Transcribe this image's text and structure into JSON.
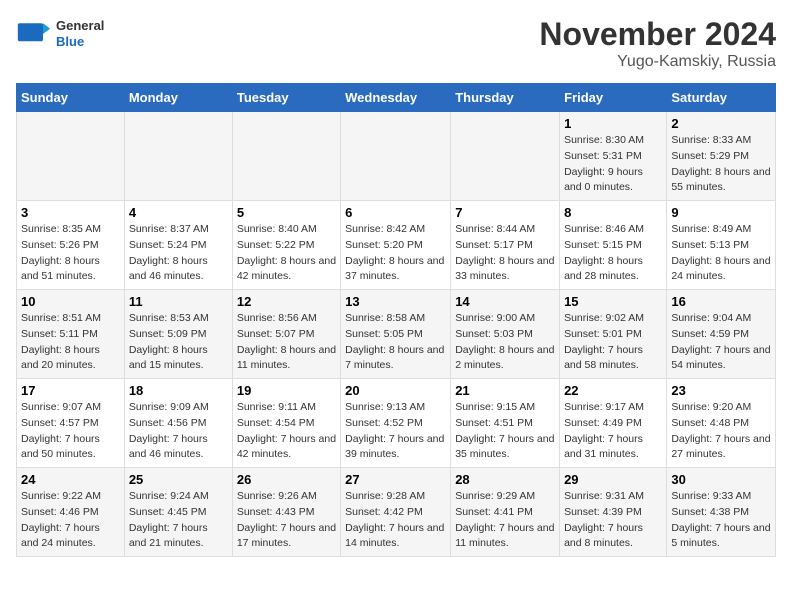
{
  "header": {
    "title": "November 2024",
    "subtitle": "Yugo-Kamskiy, Russia",
    "logo_general": "General",
    "logo_blue": "Blue"
  },
  "weekdays": [
    "Sunday",
    "Monday",
    "Tuesday",
    "Wednesday",
    "Thursday",
    "Friday",
    "Saturday"
  ],
  "weeks": [
    [
      {
        "day": "",
        "sunrise": "",
        "sunset": "",
        "daylight": ""
      },
      {
        "day": "",
        "sunrise": "",
        "sunset": "",
        "daylight": ""
      },
      {
        "day": "",
        "sunrise": "",
        "sunset": "",
        "daylight": ""
      },
      {
        "day": "",
        "sunrise": "",
        "sunset": "",
        "daylight": ""
      },
      {
        "day": "",
        "sunrise": "",
        "sunset": "",
        "daylight": ""
      },
      {
        "day": "1",
        "sunrise": "Sunrise: 8:30 AM",
        "sunset": "Sunset: 5:31 PM",
        "daylight": "Daylight: 9 hours and 0 minutes."
      },
      {
        "day": "2",
        "sunrise": "Sunrise: 8:33 AM",
        "sunset": "Sunset: 5:29 PM",
        "daylight": "Daylight: 8 hours and 55 minutes."
      }
    ],
    [
      {
        "day": "3",
        "sunrise": "Sunrise: 8:35 AM",
        "sunset": "Sunset: 5:26 PM",
        "daylight": "Daylight: 8 hours and 51 minutes."
      },
      {
        "day": "4",
        "sunrise": "Sunrise: 8:37 AM",
        "sunset": "Sunset: 5:24 PM",
        "daylight": "Daylight: 8 hours and 46 minutes."
      },
      {
        "day": "5",
        "sunrise": "Sunrise: 8:40 AM",
        "sunset": "Sunset: 5:22 PM",
        "daylight": "Daylight: 8 hours and 42 minutes."
      },
      {
        "day": "6",
        "sunrise": "Sunrise: 8:42 AM",
        "sunset": "Sunset: 5:20 PM",
        "daylight": "Daylight: 8 hours and 37 minutes."
      },
      {
        "day": "7",
        "sunrise": "Sunrise: 8:44 AM",
        "sunset": "Sunset: 5:17 PM",
        "daylight": "Daylight: 8 hours and 33 minutes."
      },
      {
        "day": "8",
        "sunrise": "Sunrise: 8:46 AM",
        "sunset": "Sunset: 5:15 PM",
        "daylight": "Daylight: 8 hours and 28 minutes."
      },
      {
        "day": "9",
        "sunrise": "Sunrise: 8:49 AM",
        "sunset": "Sunset: 5:13 PM",
        "daylight": "Daylight: 8 hours and 24 minutes."
      }
    ],
    [
      {
        "day": "10",
        "sunrise": "Sunrise: 8:51 AM",
        "sunset": "Sunset: 5:11 PM",
        "daylight": "Daylight: 8 hours and 20 minutes."
      },
      {
        "day": "11",
        "sunrise": "Sunrise: 8:53 AM",
        "sunset": "Sunset: 5:09 PM",
        "daylight": "Daylight: 8 hours and 15 minutes."
      },
      {
        "day": "12",
        "sunrise": "Sunrise: 8:56 AM",
        "sunset": "Sunset: 5:07 PM",
        "daylight": "Daylight: 8 hours and 11 minutes."
      },
      {
        "day": "13",
        "sunrise": "Sunrise: 8:58 AM",
        "sunset": "Sunset: 5:05 PM",
        "daylight": "Daylight: 8 hours and 7 minutes."
      },
      {
        "day": "14",
        "sunrise": "Sunrise: 9:00 AM",
        "sunset": "Sunset: 5:03 PM",
        "daylight": "Daylight: 8 hours and 2 minutes."
      },
      {
        "day": "15",
        "sunrise": "Sunrise: 9:02 AM",
        "sunset": "Sunset: 5:01 PM",
        "daylight": "Daylight: 7 hours and 58 minutes."
      },
      {
        "day": "16",
        "sunrise": "Sunrise: 9:04 AM",
        "sunset": "Sunset: 4:59 PM",
        "daylight": "Daylight: 7 hours and 54 minutes."
      }
    ],
    [
      {
        "day": "17",
        "sunrise": "Sunrise: 9:07 AM",
        "sunset": "Sunset: 4:57 PM",
        "daylight": "Daylight: 7 hours and 50 minutes."
      },
      {
        "day": "18",
        "sunrise": "Sunrise: 9:09 AM",
        "sunset": "Sunset: 4:56 PM",
        "daylight": "Daylight: 7 hours and 46 minutes."
      },
      {
        "day": "19",
        "sunrise": "Sunrise: 9:11 AM",
        "sunset": "Sunset: 4:54 PM",
        "daylight": "Daylight: 7 hours and 42 minutes."
      },
      {
        "day": "20",
        "sunrise": "Sunrise: 9:13 AM",
        "sunset": "Sunset: 4:52 PM",
        "daylight": "Daylight: 7 hours and 39 minutes."
      },
      {
        "day": "21",
        "sunrise": "Sunrise: 9:15 AM",
        "sunset": "Sunset: 4:51 PM",
        "daylight": "Daylight: 7 hours and 35 minutes."
      },
      {
        "day": "22",
        "sunrise": "Sunrise: 9:17 AM",
        "sunset": "Sunset: 4:49 PM",
        "daylight": "Daylight: 7 hours and 31 minutes."
      },
      {
        "day": "23",
        "sunrise": "Sunrise: 9:20 AM",
        "sunset": "Sunset: 4:48 PM",
        "daylight": "Daylight: 7 hours and 27 minutes."
      }
    ],
    [
      {
        "day": "24",
        "sunrise": "Sunrise: 9:22 AM",
        "sunset": "Sunset: 4:46 PM",
        "daylight": "Daylight: 7 hours and 24 minutes."
      },
      {
        "day": "25",
        "sunrise": "Sunrise: 9:24 AM",
        "sunset": "Sunset: 4:45 PM",
        "daylight": "Daylight: 7 hours and 21 minutes."
      },
      {
        "day": "26",
        "sunrise": "Sunrise: 9:26 AM",
        "sunset": "Sunset: 4:43 PM",
        "daylight": "Daylight: 7 hours and 17 minutes."
      },
      {
        "day": "27",
        "sunrise": "Sunrise: 9:28 AM",
        "sunset": "Sunset: 4:42 PM",
        "daylight": "Daylight: 7 hours and 14 minutes."
      },
      {
        "day": "28",
        "sunrise": "Sunrise: 9:29 AM",
        "sunset": "Sunset: 4:41 PM",
        "daylight": "Daylight: 7 hours and 11 minutes."
      },
      {
        "day": "29",
        "sunrise": "Sunrise: 9:31 AM",
        "sunset": "Sunset: 4:39 PM",
        "daylight": "Daylight: 7 hours and 8 minutes."
      },
      {
        "day": "30",
        "sunrise": "Sunrise: 9:33 AM",
        "sunset": "Sunset: 4:38 PM",
        "daylight": "Daylight: 7 hours and 5 minutes."
      }
    ]
  ]
}
